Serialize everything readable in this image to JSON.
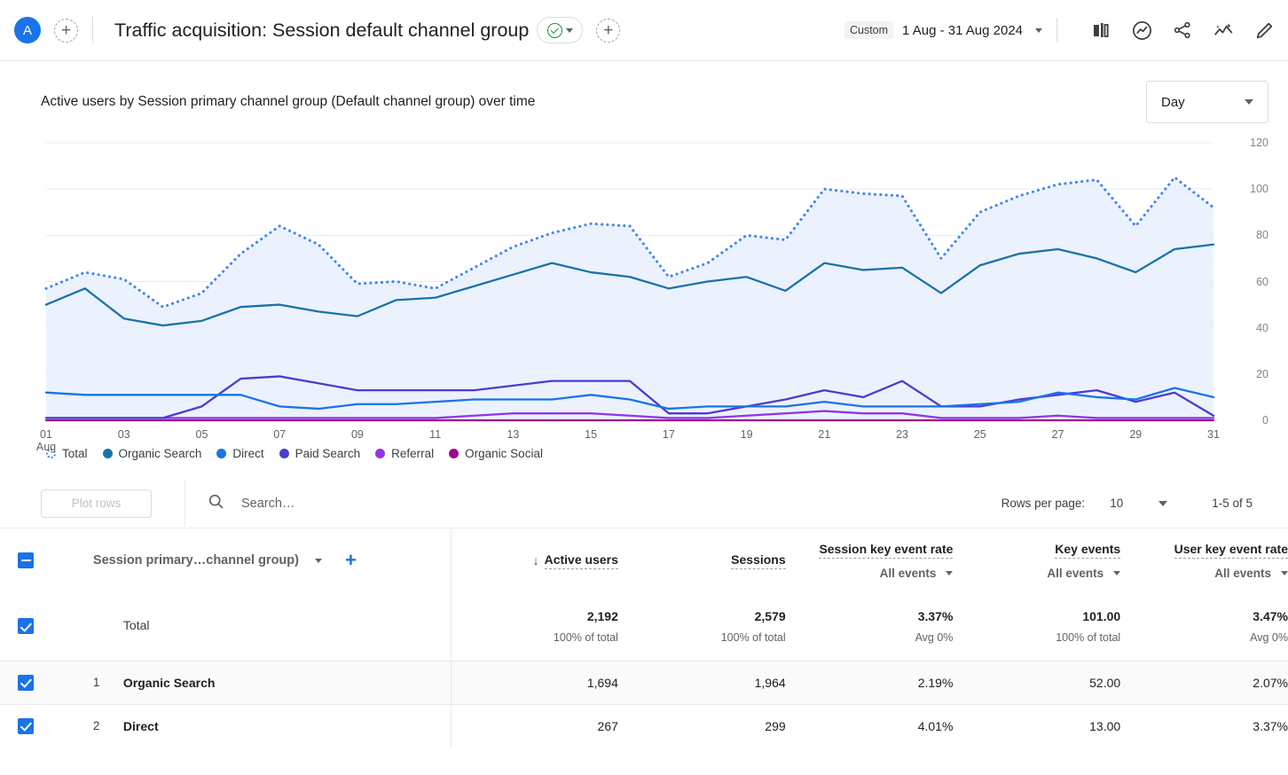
{
  "appbar": {
    "account_initial": "A",
    "add_comparison_label": "+",
    "title": "Traffic acquisition: Session default channel group",
    "insights_chip_icon": "check-circle-icon",
    "insights_chip_caret": "chevron-down-icon",
    "add_segment_label": "+",
    "date_badge": "Custom",
    "date_range": "1 Aug - 31 Aug 2024",
    "date_caret": "chevron-down-icon",
    "icons": [
      {
        "name": "compare-icon",
        "title": "Compare"
      },
      {
        "name": "insights-icon",
        "title": "Insights"
      },
      {
        "name": "share-icon",
        "title": "Share this report"
      },
      {
        "name": "sparkle-trend-icon",
        "title": "Ask Analytics Intelligence"
      },
      {
        "name": "edit-pencil-icon",
        "title": "Customize report"
      }
    ]
  },
  "chart": {
    "title": "Active users by Session primary channel group (Default channel group) over time",
    "granularity": "Day",
    "granularity_caret": "chevron-down-icon"
  },
  "chart_data": {
    "type": "line",
    "title": "Active users by Session primary channel group (Default channel group) over time",
    "xlabel": "Aug",
    "ylabel": "Active users",
    "ylim": [
      0,
      120
    ],
    "yticks": [
      0,
      20,
      40,
      60,
      80,
      100,
      120
    ],
    "grid": true,
    "legend_position": "bottom-left",
    "x": [
      "01",
      "02",
      "03",
      "04",
      "05",
      "06",
      "07",
      "08",
      "09",
      "10",
      "11",
      "12",
      "13",
      "14",
      "15",
      "16",
      "17",
      "18",
      "19",
      "20",
      "21",
      "22",
      "23",
      "24",
      "25",
      "26",
      "27",
      "28",
      "29",
      "30",
      "31"
    ],
    "xtick_labels": [
      "01",
      "03",
      "05",
      "07",
      "09",
      "11",
      "13",
      "15",
      "17",
      "19",
      "21",
      "23",
      "25",
      "27",
      "29",
      "31"
    ],
    "xtick_sublabel": "Aug",
    "series": [
      {
        "name": "Total",
        "color": "#4285f4",
        "style": "dotted",
        "area_fill": "#e8f0fe",
        "values": [
          57,
          64,
          61,
          49,
          55,
          72,
          84,
          76,
          59,
          60,
          57,
          66,
          75,
          81,
          85,
          84,
          62,
          68,
          80,
          78,
          100,
          98,
          97,
          70,
          90,
          97,
          102,
          104,
          84,
          105,
          92
        ]
      },
      {
        "name": "Organic Search",
        "color": "#1a73a7",
        "style": "solid",
        "values": [
          50,
          57,
          44,
          41,
          43,
          49,
          50,
          47,
          45,
          52,
          53,
          58,
          63,
          68,
          64,
          62,
          57,
          60,
          62,
          56,
          68,
          65,
          66,
          55,
          67,
          72,
          74,
          70,
          64,
          74,
          76
        ]
      },
      {
        "name": "Direct",
        "color": "#1a73e8",
        "style": "solid",
        "values": [
          12,
          11,
          11,
          11,
          11,
          11,
          6,
          5,
          7,
          7,
          8,
          9,
          9,
          9,
          11,
          9,
          5,
          6,
          6,
          6,
          8,
          6,
          6,
          6,
          7,
          8,
          12,
          10,
          9,
          14,
          10
        ]
      },
      {
        "name": "Paid Search",
        "color": "#4b3bd3",
        "style": "solid",
        "values": [
          1,
          1,
          1,
          1,
          6,
          18,
          19,
          16,
          13,
          13,
          13,
          13,
          15,
          17,
          17,
          17,
          3,
          3,
          6,
          9,
          13,
          10,
          17,
          6,
          6,
          9,
          11,
          13,
          8,
          12,
          2
        ]
      },
      {
        "name": "Referral",
        "color": "#9334e6",
        "style": "solid",
        "values": [
          1,
          1,
          1,
          1,
          1,
          1,
          1,
          1,
          1,
          1,
          1,
          2,
          3,
          3,
          3,
          2,
          1,
          1,
          2,
          3,
          4,
          3,
          3,
          1,
          1,
          1,
          2,
          1,
          1,
          1,
          1
        ]
      },
      {
        "name": "Organic Social",
        "color": "#a1008b",
        "style": "solid",
        "values": [
          0,
          0,
          0,
          0,
          0,
          0,
          0,
          0,
          0,
          0,
          0,
          0,
          0,
          0,
          0,
          0,
          0,
          0,
          0,
          0,
          0,
          0,
          0,
          0,
          0,
          0,
          0,
          0,
          0,
          0,
          0
        ]
      }
    ]
  },
  "table_controls": {
    "plot_rows_label": "Plot rows",
    "search_icon": "search-icon",
    "search_placeholder": "Search…",
    "rows_per_page_label": "Rows per page:",
    "rows_per_page_value": "10",
    "rows_per_page_caret": "chevron-down-icon",
    "pagination_range": "1-5 of 5"
  },
  "table": {
    "dimension_header": {
      "label": "Session primary…channel group)",
      "caret": "chevron-down-icon",
      "add_icon": "plus-icon"
    },
    "metric_headers": [
      {
        "name": "Active users",
        "sort_icon": "arrow-down-icon",
        "sorted": true,
        "sub": null,
        "sub_caret": null
      },
      {
        "name": "Sessions",
        "sort_icon": null,
        "sorted": false,
        "sub": null,
        "sub_caret": null
      },
      {
        "name": "Session key event rate",
        "sort_icon": null,
        "sorted": false,
        "sub": "All events",
        "sub_caret": "chevron-down-icon"
      },
      {
        "name": "Key events",
        "sort_icon": null,
        "sorted": false,
        "sub": "All events",
        "sub_caret": "chevron-down-icon"
      },
      {
        "name": "User key event rate",
        "sort_icon": null,
        "sorted": false,
        "sub": "All events",
        "sub_caret": "chevron-down-icon"
      }
    ],
    "total_row": {
      "checkbox": "checked",
      "label": "Total",
      "cells": [
        {
          "main": "2,192",
          "sub": "100% of total"
        },
        {
          "main": "2,579",
          "sub": "100% of total"
        },
        {
          "main": "3.37%",
          "sub": "Avg 0%"
        },
        {
          "main": "101.00",
          "sub": "100% of total"
        },
        {
          "main": "3.47%",
          "sub": "Avg 0%"
        }
      ]
    },
    "rows": [
      {
        "checkbox": "checked",
        "rank": "1",
        "name": "Organic Search",
        "cells": [
          "1,694",
          "1,964",
          "2.19%",
          "52.00",
          "2.07%"
        ]
      },
      {
        "checkbox": "checked",
        "rank": "2",
        "name": "Direct",
        "cells": [
          "267",
          "299",
          "4.01%",
          "13.00",
          "3.37%"
        ]
      }
    ]
  }
}
